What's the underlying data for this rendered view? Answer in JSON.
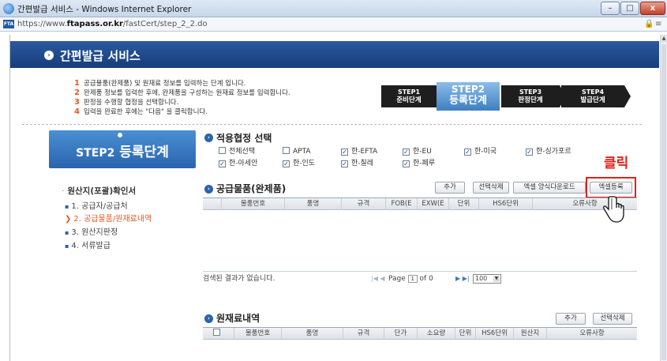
{
  "window": {
    "title": "간편발급 서비스 - Windows Internet Explorer",
    "min_label": "–",
    "max_label": "□",
    "close_label": "x"
  },
  "address": {
    "url_prefix": "https://www.",
    "url_host": "ftapass.or.kr",
    "url_path": "/fastCert/step_2_2.do",
    "site_icon": "FTA"
  },
  "header": {
    "title": "간편발급 서비스"
  },
  "instructions": [
    {
      "num": "1",
      "text": "공급물품(완제품) 및 원재료 정보를 입력하는 단계 입니다."
    },
    {
      "num": "2",
      "text": "완제품 정보를 입력한 후에, 완제품을 구성하는 원재료 정보를 입력합니다."
    },
    {
      "num": "3",
      "text": "판정을 수행할 협정을 선택합니다."
    },
    {
      "num": "4",
      "text": "입력을 완료한 후에는 \"다음\" 을 클릭합니다."
    }
  ],
  "steps": [
    {
      "line1": "STEP1",
      "line2": "준비단계"
    },
    {
      "line1": "STEP2",
      "line2": "등록단계"
    },
    {
      "line1": "STEP3",
      "line2": "판정단계"
    },
    {
      "line1": "STEP4",
      "line2": "발급단계"
    }
  ],
  "sidebar": {
    "step_box_prefix": "STEP2",
    "step_box_label": "등록단계",
    "title": "원산지(포괄)확인서",
    "items": [
      {
        "label": "1. 공급자/공급처",
        "active": false
      },
      {
        "label": "2. 공급물품/원재료내역",
        "active": true
      },
      {
        "label": "3. 원산지판정",
        "active": false
      },
      {
        "label": "4. 서류발급",
        "active": false
      }
    ]
  },
  "agreement": {
    "title": "적용협정 선택",
    "options": [
      {
        "label": "전체선택",
        "checked": false
      },
      {
        "label": "APTA",
        "checked": false
      },
      {
        "label": "한-EFTA",
        "checked": true
      },
      {
        "label": "한-EU",
        "checked": true
      },
      {
        "label": "한-미국",
        "checked": true
      },
      {
        "label": "한-싱가포르",
        "checked": true
      },
      {
        "label": "한-아세안",
        "checked": true
      },
      {
        "label": "한-인도",
        "checked": true
      },
      {
        "label": "한-칠레",
        "checked": true
      },
      {
        "label": "한-페루",
        "checked": true
      }
    ]
  },
  "click_annotation": "클릭",
  "products": {
    "title": "공급물품(완제품)",
    "buttons": {
      "add": "추가",
      "delete": "선택삭제",
      "excel_template": "엑셀 양식다운로드",
      "excel_upload": "엑셀등록"
    },
    "columns": [
      "",
      "물품번호",
      "품명",
      "규격",
      "FOB(E",
      "EXW(E",
      "단위",
      "HS6단위",
      "오류사항"
    ],
    "empty_text": "검색된 결과가 없습니다.",
    "paging": {
      "first_prev": "|◀ ◀",
      "page_label": "Page",
      "page_value": "1",
      "of_label": "of 0",
      "next_last": "▶ ▶|",
      "page_size": "100"
    }
  },
  "materials": {
    "title": "원재료내역",
    "buttons": {
      "add": "추가",
      "delete": "선택삭제"
    },
    "columns": [
      "",
      "물품번호",
      "품명",
      "규격",
      "단가",
      "소요량",
      "단위",
      "HS6단위",
      "원산지",
      "오류사항"
    ]
  },
  "colors": {
    "header_blue": "#1f4f99",
    "accent_orange": "#e65a1e",
    "annotation_red": "#e0211b",
    "step_active": "#5a9ad8"
  }
}
